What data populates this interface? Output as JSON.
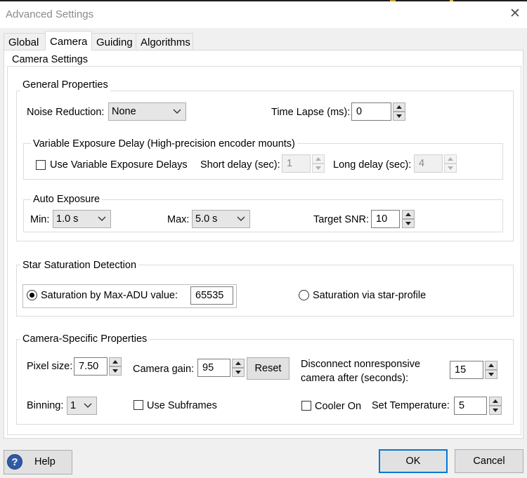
{
  "window": {
    "title": "Advanced Settings",
    "close_icon": "close-icon"
  },
  "tabs": [
    {
      "label": "Global",
      "active": false
    },
    {
      "label": "Camera",
      "active": true
    },
    {
      "label": "Guiding",
      "active": false
    },
    {
      "label": "Algorithms",
      "active": false
    }
  ],
  "camera_settings": {
    "group_label": "Camera Settings",
    "general": {
      "group_label": "General Properties",
      "noise_reduction": {
        "label": "Noise Reduction:",
        "value": "None"
      },
      "time_lapse": {
        "label": "Time Lapse (ms):",
        "value": "0"
      },
      "variable_exposure": {
        "group_label": "Variable Exposure Delay (High-precision encoder mounts)",
        "use_label": "Use Variable Exposure Delays",
        "use_checked": false,
        "short_delay": {
          "label": "Short delay (sec):",
          "value": "1",
          "enabled": false
        },
        "long_delay": {
          "label": "Long delay (sec):",
          "value": "4",
          "enabled": false
        }
      },
      "auto_exposure": {
        "group_label": "Auto Exposure",
        "min": {
          "label": "Min:",
          "value": "1.0 s"
        },
        "max": {
          "label": "Max:",
          "value": "5.0 s"
        },
        "target_snr": {
          "label": "Target SNR:",
          "value": "10"
        }
      }
    },
    "saturation": {
      "group_label": "Star Saturation Detection",
      "max_adu": {
        "label": "Saturation by Max-ADU value:",
        "value": "65535",
        "selected": true
      },
      "star_profile": {
        "label": "Saturation via star-profile",
        "selected": false
      }
    },
    "camera_specific": {
      "group_label": "Camera-Specific Properties",
      "pixel_size": {
        "label": "Pixel size:",
        "value": "7.50"
      },
      "camera_gain": {
        "label": "Camera gain:",
        "value": "95"
      },
      "reset_label": "Reset",
      "disconnect": {
        "label_line1": "Disconnect nonresponsive",
        "label_line2": "camera after (seconds):",
        "value": "15"
      },
      "binning": {
        "label": "Binning:",
        "value": "1"
      },
      "use_subframes": {
        "label": "Use Subframes",
        "checked": false
      },
      "cooler_on": {
        "label": "Cooler On",
        "checked": false
      },
      "set_temperature": {
        "label": "Set Temperature:",
        "value": "5"
      }
    }
  },
  "footer": {
    "help_label": "Help",
    "help_icon_glyph": "?",
    "ok_label": "OK",
    "cancel_label": "Cancel"
  }
}
